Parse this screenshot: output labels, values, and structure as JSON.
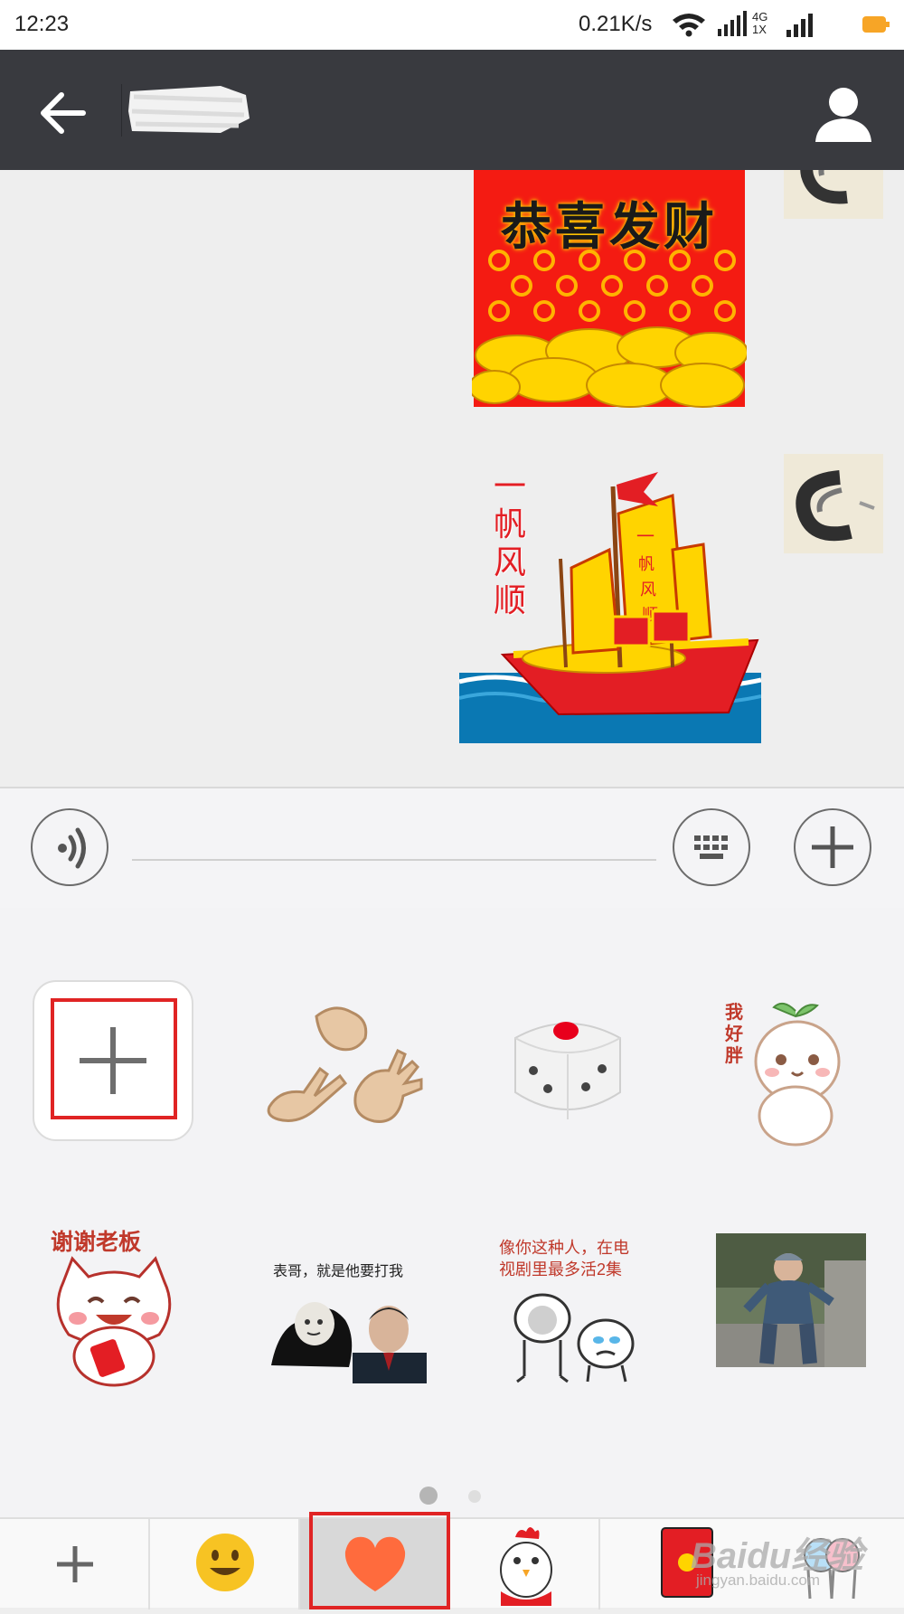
{
  "status_bar": {
    "time": "12:23",
    "speed": "0.21K/s",
    "network_top": "4G",
    "network_bottom": "1X"
  },
  "title_bar": {
    "back_icon": "arrow-left-icon",
    "profile_icon": "person-icon"
  },
  "messages": [
    {
      "type": "sticker",
      "text": "恭喜发财",
      "sender": "me"
    },
    {
      "type": "sticker",
      "text": "一帆风顺",
      "sender": "me"
    }
  ],
  "input_bar": {
    "voice_icon": "voice-icon",
    "keyboard_icon": "keyboard-icon",
    "more_icon": "plus-icon",
    "input_value": ""
  },
  "sticker_panel": {
    "stickers": [
      {
        "name": "add-sticker",
        "icon": "plus-icon"
      },
      {
        "name": "rock-paper-scissors",
        "icon": "hands-icon"
      },
      {
        "name": "dice",
        "icon": "dice-icon"
      },
      {
        "name": "sprout-character",
        "caption": "我好胖"
      },
      {
        "name": "cat-red-envelope",
        "caption": "谢谢老板"
      },
      {
        "name": "panda-meme",
        "caption": "表哥，就是他要打我"
      },
      {
        "name": "cat-dog-meme",
        "caption": "像你这种人，在电视剧里最多活2集"
      },
      {
        "name": "dancing-kid-photo"
      }
    ],
    "page": 1,
    "page_count": 2
  },
  "tabs": [
    {
      "name": "add",
      "icon": "plus-icon"
    },
    {
      "name": "emoji",
      "icon": "smiley-icon"
    },
    {
      "name": "favorites",
      "icon": "heart-icon",
      "selected": true
    },
    {
      "name": "chicken-pack",
      "icon": "rooster-icon"
    },
    {
      "name": "red-packet-pack",
      "icon": "red-envelope-icon"
    }
  ],
  "watermark": {
    "brand": "Baidu经验",
    "url": "jingyan.baidu.com"
  },
  "colors": {
    "title_bar": "#393a3f",
    "highlight_red": "#e02424",
    "heart": "#ff6b3d"
  }
}
